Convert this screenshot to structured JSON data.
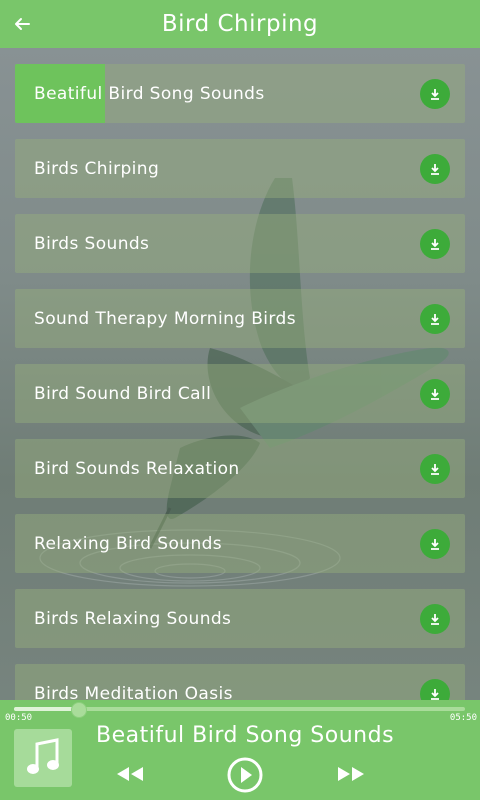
{
  "header": {
    "title": "Bird Chirping"
  },
  "tracks": [
    {
      "label": "Beatiful Bird Song Sounds",
      "active": true
    },
    {
      "label": "Birds Chirping"
    },
    {
      "label": "Birds Sounds"
    },
    {
      "label": "Sound Therapy Morning Birds"
    },
    {
      "label": "Bird Sound Bird Call"
    },
    {
      "label": "Bird Sounds Relaxation"
    },
    {
      "label": "Relaxing Bird Sounds"
    },
    {
      "label": "Birds Relaxing Sounds"
    },
    {
      "label": "Birds Meditation Oasis"
    }
  ],
  "player": {
    "current_time": "00:50",
    "total_time": "05:50",
    "progress": 0.143,
    "now_playing": "Beatiful Bird Song Sounds"
  },
  "colors": {
    "accent": "#79c66a",
    "download": "#3dab3a"
  },
  "icons": {
    "back": "back-arrow-icon",
    "download": "download-icon",
    "music": "music-note-icon",
    "rewind": "rewind-icon",
    "play": "play-icon",
    "forward": "fast-forward-icon"
  }
}
